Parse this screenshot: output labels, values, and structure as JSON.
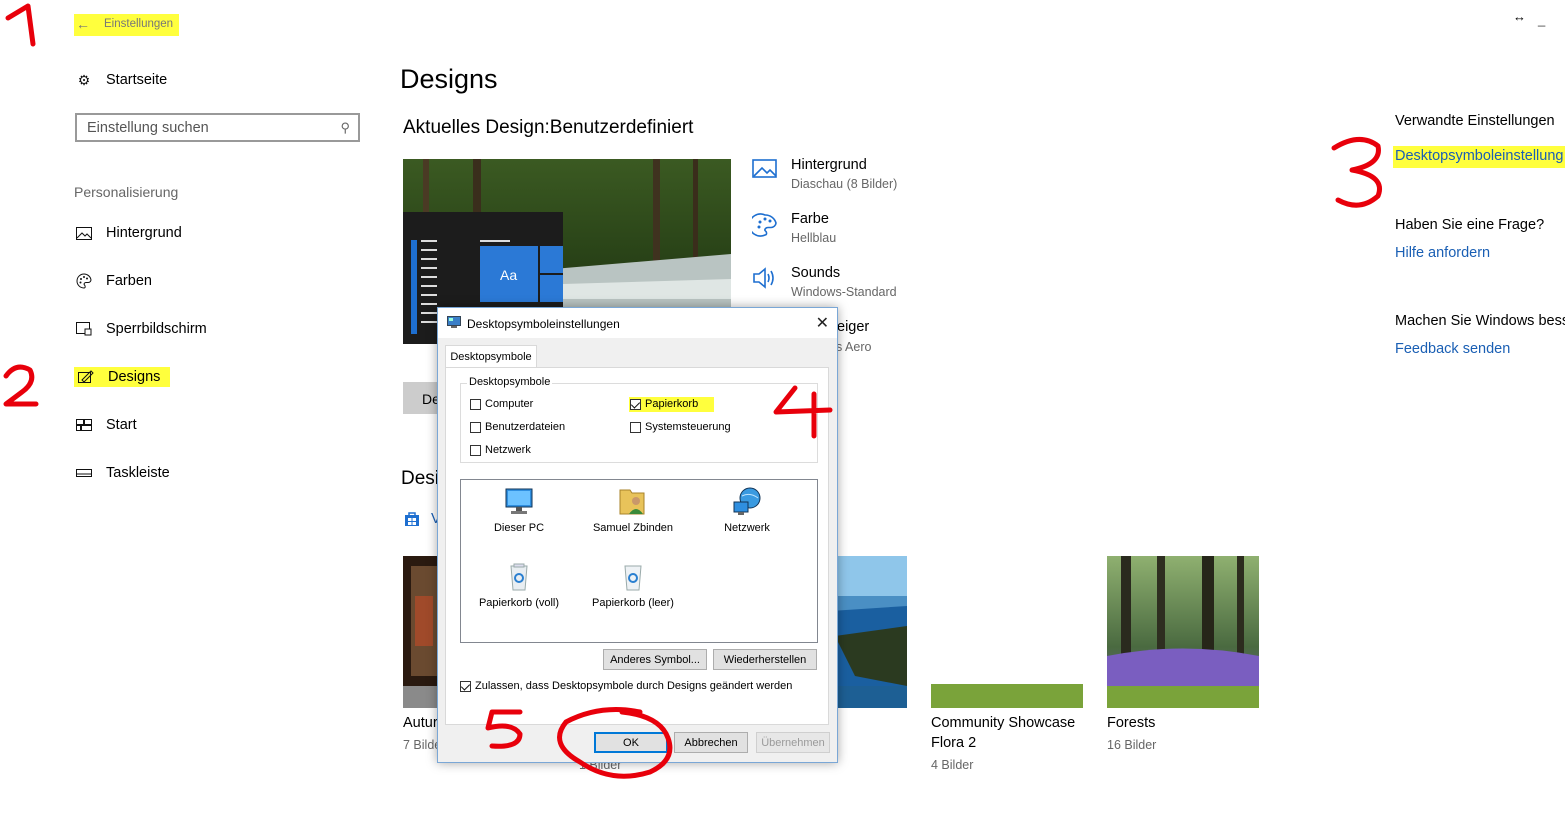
{
  "window": {
    "back_label": "Einstellungen",
    "controls": {
      "resize": "↔",
      "minimize": "_"
    }
  },
  "sidebar": {
    "home": "Startseite",
    "search_placeholder": "Einstellung suchen",
    "section": "Personalisierung",
    "items": [
      {
        "label": "Hintergrund",
        "icon": "image-icon"
      },
      {
        "label": "Farben",
        "icon": "palette-icon"
      },
      {
        "label": "Sperrbildschirm",
        "icon": "lock-screen-icon"
      },
      {
        "label": "Designs",
        "icon": "designs-icon",
        "selected": true
      },
      {
        "label": "Start",
        "icon": "start-icon"
      },
      {
        "label": "Taskleiste",
        "icon": "taskbar-icon"
      }
    ]
  },
  "main": {
    "title": "Designs",
    "current_design": "Aktuelles Design:Benutzerdefiniert",
    "preview_tile_text": "Aa",
    "save_button_fragment": "De",
    "section_fragment": "Desi",
    "store_fragment": "V",
    "props": [
      {
        "title": "Hintergrund",
        "sub": "Diaschau (8 Bilder)"
      },
      {
        "title": "Farbe",
        "sub": "Hellblau"
      },
      {
        "title": "Sounds",
        "sub": "Windows-Standard"
      },
      {
        "title": "eiger",
        "sub": "s Aero"
      }
    ],
    "themes": [
      {
        "name": "Autur",
        "count": "7 Bilde"
      },
      {
        "name": "",
        "count": "1 Bilder"
      },
      {
        "name": "Community Showcase Flora 2",
        "line1": "Community Showcase",
        "line2": "Flora 2",
        "count": "4 Bilder"
      },
      {
        "name": "Forests",
        "count": "16 Bilder"
      }
    ]
  },
  "related": {
    "heading": "Verwandte Einstellungen",
    "link": "Desktopsymboleinstellung",
    "question": "Haben Sie eine Frage?",
    "help_link": "Hilfe anfordern",
    "improve": "Machen Sie Windows bess",
    "feedback_link": "Feedback senden"
  },
  "dialog": {
    "title": "Desktopsymboleinstellungen",
    "tab": "Desktopsymbole",
    "group": "Desktopsymbole",
    "checkboxes": [
      {
        "label": "Computer",
        "checked": false
      },
      {
        "label": "Papierkorb",
        "checked": true
      },
      {
        "label": "Benutzerdateien",
        "checked": false
      },
      {
        "label": "Systemsteuerung",
        "checked": false
      },
      {
        "label": "Netzwerk",
        "checked": false
      }
    ],
    "icons": [
      "Dieser PC",
      "Samuel Zbinden",
      "Netzwerk",
      "Papierkorb (voll)",
      "Papierkorb (leer)"
    ],
    "change_icon": "Anderes Symbol...",
    "restore": "Wiederherstellen",
    "allow": "Zulassen, dass Desktopsymbole durch Designs geändert werden",
    "allow_checked": true,
    "ok": "OK",
    "cancel": "Abbrechen",
    "apply": "Übernehmen"
  },
  "annotations": [
    "1",
    "2",
    "3",
    "4",
    "5"
  ],
  "colors": {
    "accent": "#0078d7",
    "link": "#1a5fb4",
    "highlight": "#ffff3d",
    "annotation": "#e8000b",
    "flora_bar": "#7aa33a"
  }
}
